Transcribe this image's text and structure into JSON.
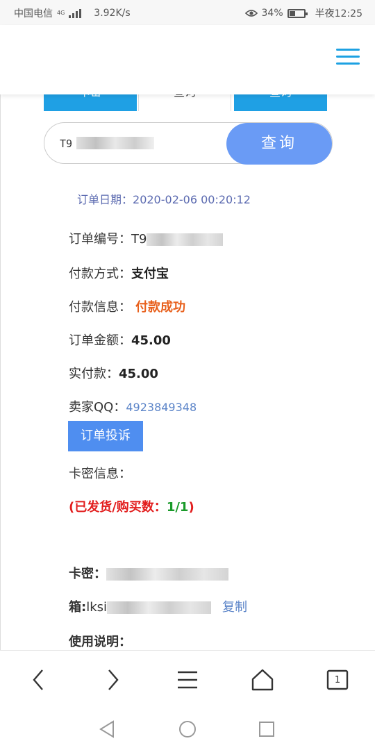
{
  "status_bar": {
    "carrier": "中国电信",
    "network": "4G",
    "speed": "3.92K/s",
    "battery": "34%",
    "time": "半夜12:25"
  },
  "tabs": [
    "卡密",
    "查询",
    "查询"
  ],
  "search": {
    "value": "T9",
    "button": "查询"
  },
  "order": {
    "date_label": "订单日期：",
    "date": "2020-02-06 00:20:12",
    "number_label": "订单编号：",
    "number": "T9",
    "pay_method_label": "付款方式：",
    "pay_method": "支付宝",
    "pay_info_label": "付款信息：",
    "pay_info": "付款成功",
    "amount_label": "订单金额：",
    "amount": "45.00",
    "paid_label": "实付款：",
    "paid": "45.00",
    "seller_qq_label": "卖家QQ：",
    "seller_qq": "4923849348",
    "complaint_button": "订单投诉",
    "card_info_label": "卡密信息：",
    "delivered_prefix": "(已发货/购买数：",
    "delivered_count": "1/1",
    "delivered_suffix": ")",
    "card_label": "卡密：",
    "card_value": "",
    "email_label": "箱:",
    "email_value": "lksi",
    "copy_label": "复制",
    "usage_label": "使用说明："
  },
  "toolbar": {
    "back": "back-icon",
    "forward": "forward-icon",
    "menu": "menu-icon",
    "home": "home-icon",
    "tab_count": "1"
  },
  "colors": {
    "accent": "#1da1e2",
    "search_button": "#6a9bf5",
    "complaint_button": "#4f8ef0",
    "success": "#e8601c",
    "delivered": "#e21d1d",
    "count": "#1a9a2a"
  }
}
